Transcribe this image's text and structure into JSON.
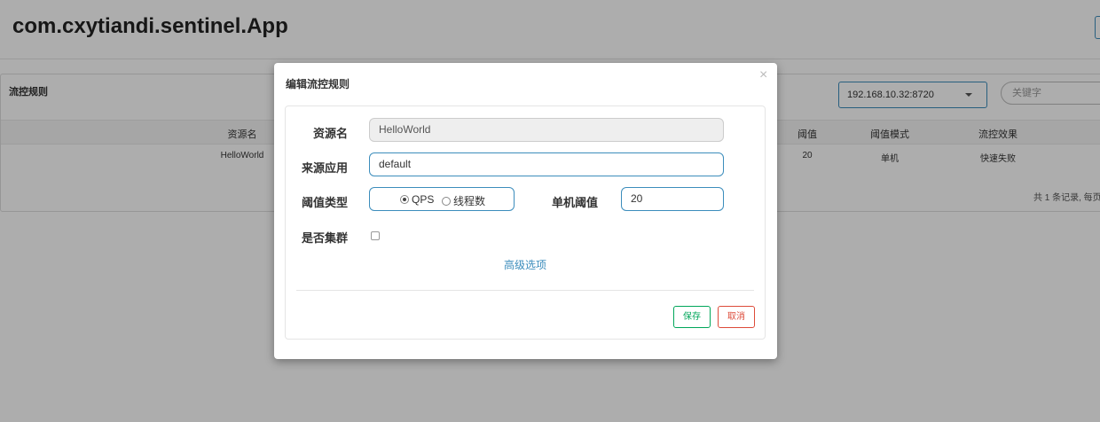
{
  "app": {
    "title": "com.cxytiandi.sentinel.App"
  },
  "panel": {
    "title": "流控规则",
    "machine_select": "192.168.10.32:8720",
    "search_placeholder": "关键字"
  },
  "table": {
    "columns": {
      "resource": "资源名",
      "threshold": "阈值",
      "threshold_mode": "阈值模式",
      "control_effect": "流控效果"
    },
    "rows": [
      {
        "resource": "HelloWorld",
        "threshold": "20",
        "threshold_mode": "单机",
        "control_effect": "快速失败"
      }
    ],
    "pagination_text": "共 1 条记录, 每页"
  },
  "modal": {
    "title": "编辑流控规则",
    "close_glyph": "×",
    "fields": {
      "resource_label": "资源名",
      "resource_value": "HelloWorld",
      "source_label": "来源应用",
      "source_value": "default",
      "threshold_type_label": "阈值类型",
      "threshold_type_options": [
        "QPS",
        "线程数"
      ],
      "threshold_type_selected": "QPS",
      "single_threshold_label": "单机阈值",
      "single_threshold_value": "20",
      "cluster_label": "是否集群",
      "cluster_checked": false
    },
    "advanced_link": "高级选项",
    "save_label": "保存",
    "cancel_label": "取消"
  },
  "colors": {
    "primary": "#3c8dbc",
    "success": "#00a65a",
    "danger": "#dd4b39"
  }
}
